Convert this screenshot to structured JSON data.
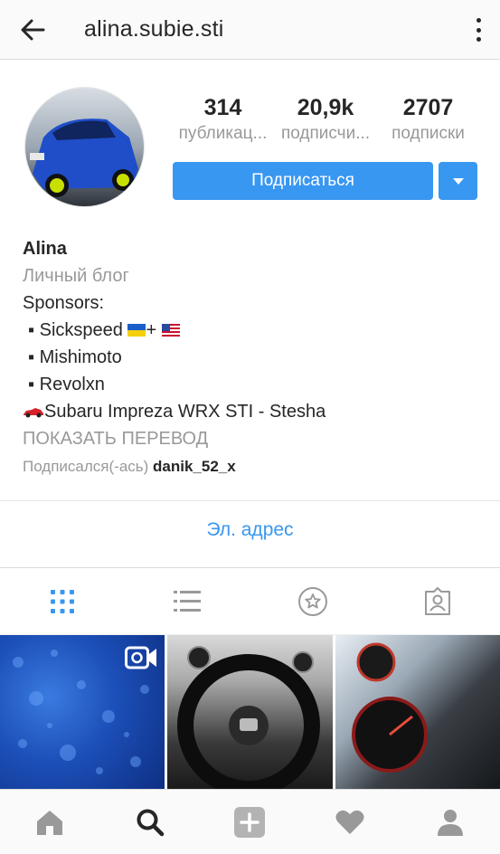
{
  "header": {
    "username": "alina.subie.sti"
  },
  "stats": [
    {
      "value": "314",
      "label": "публикац..."
    },
    {
      "value": "20,9k",
      "label": "подписчи..."
    },
    {
      "value": "2707",
      "label": "подписки"
    }
  ],
  "actions": {
    "follow_label": "Подписаться"
  },
  "bio": {
    "name": "Alina",
    "category": "Личный блог",
    "sponsors_heading": "Sponsors:",
    "sponsor_1": "▪ Sickspeed",
    "sponsor_1_suffix": "+",
    "sponsor_2": "▪ Mishimoto",
    "sponsor_3": "▪ Revolxn",
    "car_line": "Subaru Impreza WRX STI - Stesha",
    "translate_label": "ПОКАЗАТЬ ПЕРЕВОД",
    "followed_by_prefix": "Подписался(-ась)",
    "followed_by_user": "danik_52_x"
  },
  "contact": {
    "email_label": "Эл. адрес"
  },
  "colors": {
    "accent": "#3897f0",
    "muted": "#999999",
    "text": "#262626"
  },
  "tabs": [
    {
      "icon": "grid-icon",
      "active": true
    },
    {
      "icon": "list-icon",
      "active": false
    },
    {
      "icon": "star-circle-icon",
      "active": false
    },
    {
      "icon": "tagged-person-icon",
      "active": false
    }
  ],
  "posts": [
    {
      "overlay_icon": "video-camera-icon"
    },
    {},
    {}
  ],
  "bottom_nav": [
    {
      "icon": "home-icon"
    },
    {
      "icon": "search-icon"
    },
    {
      "icon": "add-post-icon"
    },
    {
      "icon": "heart-icon"
    },
    {
      "icon": "profile-icon"
    }
  ]
}
